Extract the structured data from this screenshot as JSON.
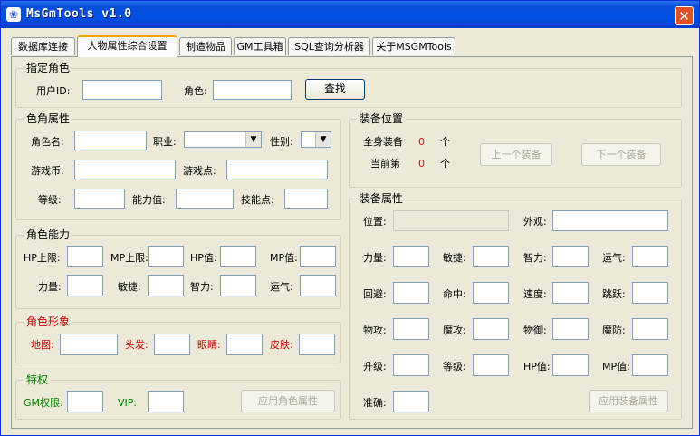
{
  "window": {
    "title": "MsGmTools v1.0",
    "close_glyph": "✕"
  },
  "tabs": [
    {
      "label": "数据库连接"
    },
    {
      "label": "人物属性综合设置"
    },
    {
      "label": "制造物品"
    },
    {
      "label": "GM工具箱"
    },
    {
      "label": "SQL查询分析器"
    },
    {
      "label": "关于MSGMTools"
    }
  ],
  "specify_role": {
    "title": "指定角色",
    "user_id_label": "用户ID:",
    "user_id_value": "",
    "role_label": "角色:",
    "role_value": "",
    "find_button": "查找"
  },
  "role_attrs": {
    "title": "色角属性",
    "name_label": "角色名:",
    "job_label": "职业:",
    "gender_label": "性别:",
    "money_label": "游戏币:",
    "points_label": "游戏点:",
    "level_label": "等级:",
    "ability_label": "能力值:",
    "skill_label": "技能点:",
    "job_value": "",
    "gender_value": ""
  },
  "role_ability": {
    "title": "角色能力",
    "hp_max_label": "HP上限:",
    "mp_max_label": "MP上限:",
    "hp_label": "HP值:",
    "mp_label": "MP值:",
    "str_label": "力量:",
    "dex_label": "敏捷:",
    "int_label": "智力:",
    "luk_label": "运气:"
  },
  "role_image": {
    "title": "角色形象",
    "map_label": "地图:",
    "hair_label": "头发:",
    "eyes_label": "眼睛:",
    "skin_label": "皮肤:"
  },
  "privilege": {
    "title": "特权",
    "gm_label": "GM权限:",
    "vip_label": "VIP:",
    "apply_button": "应用角色属性"
  },
  "equip_pos": {
    "title": "装备位置",
    "total_label": "全身装备",
    "total_value": "0",
    "total_unit": "个",
    "current_label": "当前第",
    "current_value": "0",
    "current_unit": "个",
    "prev_button": "上一个装备",
    "next_button": "下一个装备"
  },
  "equip_attrs": {
    "title": "装备属性",
    "pos_label": "位置:",
    "look_label": "外观:",
    "str_label": "力量:",
    "dex_label": "敏捷:",
    "int_label": "智力:",
    "luk_label": "运气:",
    "avoid_label": "回避:",
    "hit_label": "命中:",
    "speed_label": "速度:",
    "jump_label": "跳跃:",
    "watk_label": "物攻:",
    "matk_label": "魔攻:",
    "wdef_label": "物御:",
    "mdef_label": "魔防:",
    "upgrade_label": "升级:",
    "level_label": "等级:",
    "hp_label": "HP值:",
    "mp_label": "MP值:",
    "acc_label": "准确:",
    "apply_button": "应用装备属性"
  },
  "colors": {
    "label_red": "#d00000",
    "label_green": "#008000",
    "value_red": "#ff0000",
    "titlebar": "#0054e3"
  }
}
